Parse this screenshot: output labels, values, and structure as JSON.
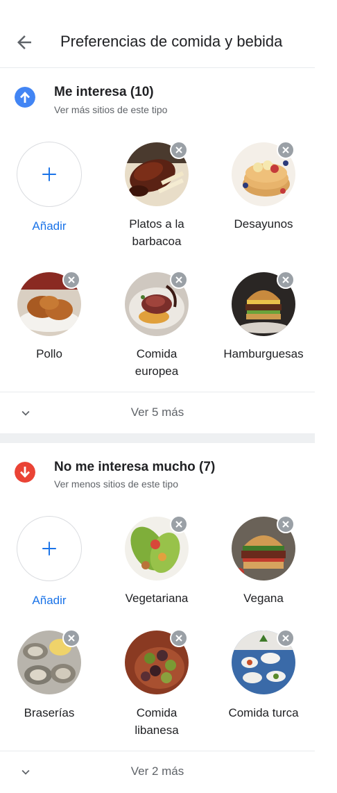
{
  "header": {
    "title": "Preferencias de comida y bebida"
  },
  "sections": [
    {
      "title": "Me interesa (10)",
      "subtitle": "Ver más sitios de este tipo",
      "icon": "thumb-up-arrow-icon",
      "color": "#4285f4",
      "add_label": "Añadir",
      "items": [
        {
          "label_lines": [
            "Platos a la",
            "barbacoa"
          ]
        },
        {
          "label_lines": [
            "Desayunos"
          ]
        },
        {
          "label_lines": [
            "Pollo"
          ]
        },
        {
          "label_lines": [
            "Comida",
            "europea"
          ]
        },
        {
          "label_lines": [
            "Hamburguesas"
          ]
        }
      ],
      "more_label": "Ver 5 más"
    },
    {
      "title": "No me interesa mucho (7)",
      "subtitle": "Ver menos sitios de este tipo",
      "icon": "thumb-down-arrow-icon",
      "color": "#ea4335",
      "add_label": "Añadir",
      "items": [
        {
          "label_lines": [
            "Vegetariana"
          ]
        },
        {
          "label_lines": [
            "Vegana"
          ]
        },
        {
          "label_lines": [
            "Braserías"
          ]
        },
        {
          "label_lines": [
            "Comida",
            "libanesa"
          ]
        },
        {
          "label_lines": [
            "Comida turca"
          ]
        }
      ],
      "more_label": "Ver 2 más"
    }
  ]
}
